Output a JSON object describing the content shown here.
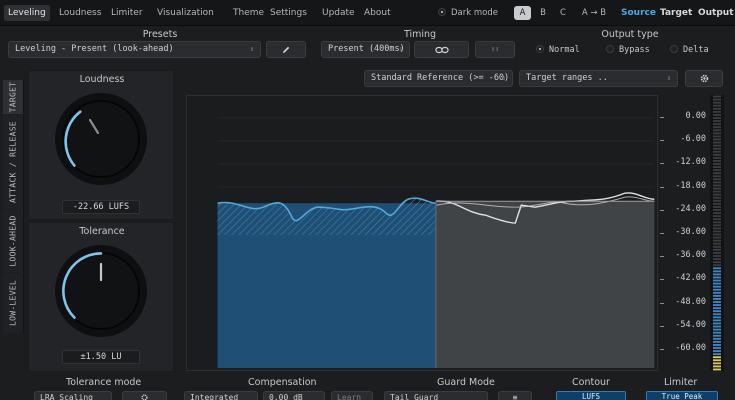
{
  "menu": {
    "tabs": [
      {
        "label": "Leveling",
        "active": true
      },
      {
        "label": "Loudness"
      },
      {
        "label": "Limiter"
      },
      {
        "label": "Visualization"
      },
      {
        "label": "Theme"
      },
      {
        "label": "Settings"
      },
      {
        "label": "Update"
      },
      {
        "label": "About"
      }
    ],
    "dark_mode_label": "Dark mode",
    "ab": [
      "A",
      "B",
      "C",
      "A → B"
    ],
    "ab_selected": "A",
    "source": "Source",
    "target": "Target",
    "output": "Output"
  },
  "presets": {
    "title": "Presets",
    "value": "Leveling - Present (look-ahead)",
    "edit_icon": "pencil-icon"
  },
  "timing": {
    "title": "Timing",
    "value": "Present (400ms)",
    "link_icon": "link-icon",
    "extra": "ı ı"
  },
  "output_type": {
    "title": "Output type",
    "options": [
      "Normal",
      "Bypass",
      "Delta"
    ],
    "selected": "Normal"
  },
  "reference": {
    "value": "Standard Reference (>= -60)",
    "ranges": "Target ranges ..",
    "gear_icon": "gear-icon"
  },
  "side_tabs": [
    "TARGET",
    "ATTACK / RELEASE",
    "LOOK-AHEAD",
    "LOW-LEVEL"
  ],
  "loudness": {
    "title": "Loudness",
    "readout": "-22.66 LUFS",
    "value_lufs": -22.66
  },
  "tolerance": {
    "title": "Tolerance",
    "readout": "±1.50 LU",
    "value_lu": 1.5
  },
  "scale": [
    "0.00",
    "-6.00",
    "-12.00",
    "-18.00",
    "-24.00",
    "-30.00",
    "-36.00",
    "-42.00",
    "-48.00",
    "-54.00",
    "-60.00"
  ],
  "meter": {
    "level": 0.38
  },
  "bottom": {
    "tolerance_mode_title": "Tolerance mode",
    "tolerance_mode_value": "LRA Scaling",
    "compensation_title": "Compensation",
    "compensation_mode": "Integrated",
    "compensation_value": "0.00 dB",
    "compensation_learn": "Learn",
    "guard_title": "Guard Mode",
    "guard_value": "Tail Guard",
    "contour_title": "Contour",
    "contour_value": "LUFS",
    "limiter_title": "Limiter",
    "limiter_value": "True Peak"
  },
  "colors": {
    "accent": "#4aa8e6",
    "fill": "#1f4f74",
    "bg": "#1c1d1f"
  }
}
